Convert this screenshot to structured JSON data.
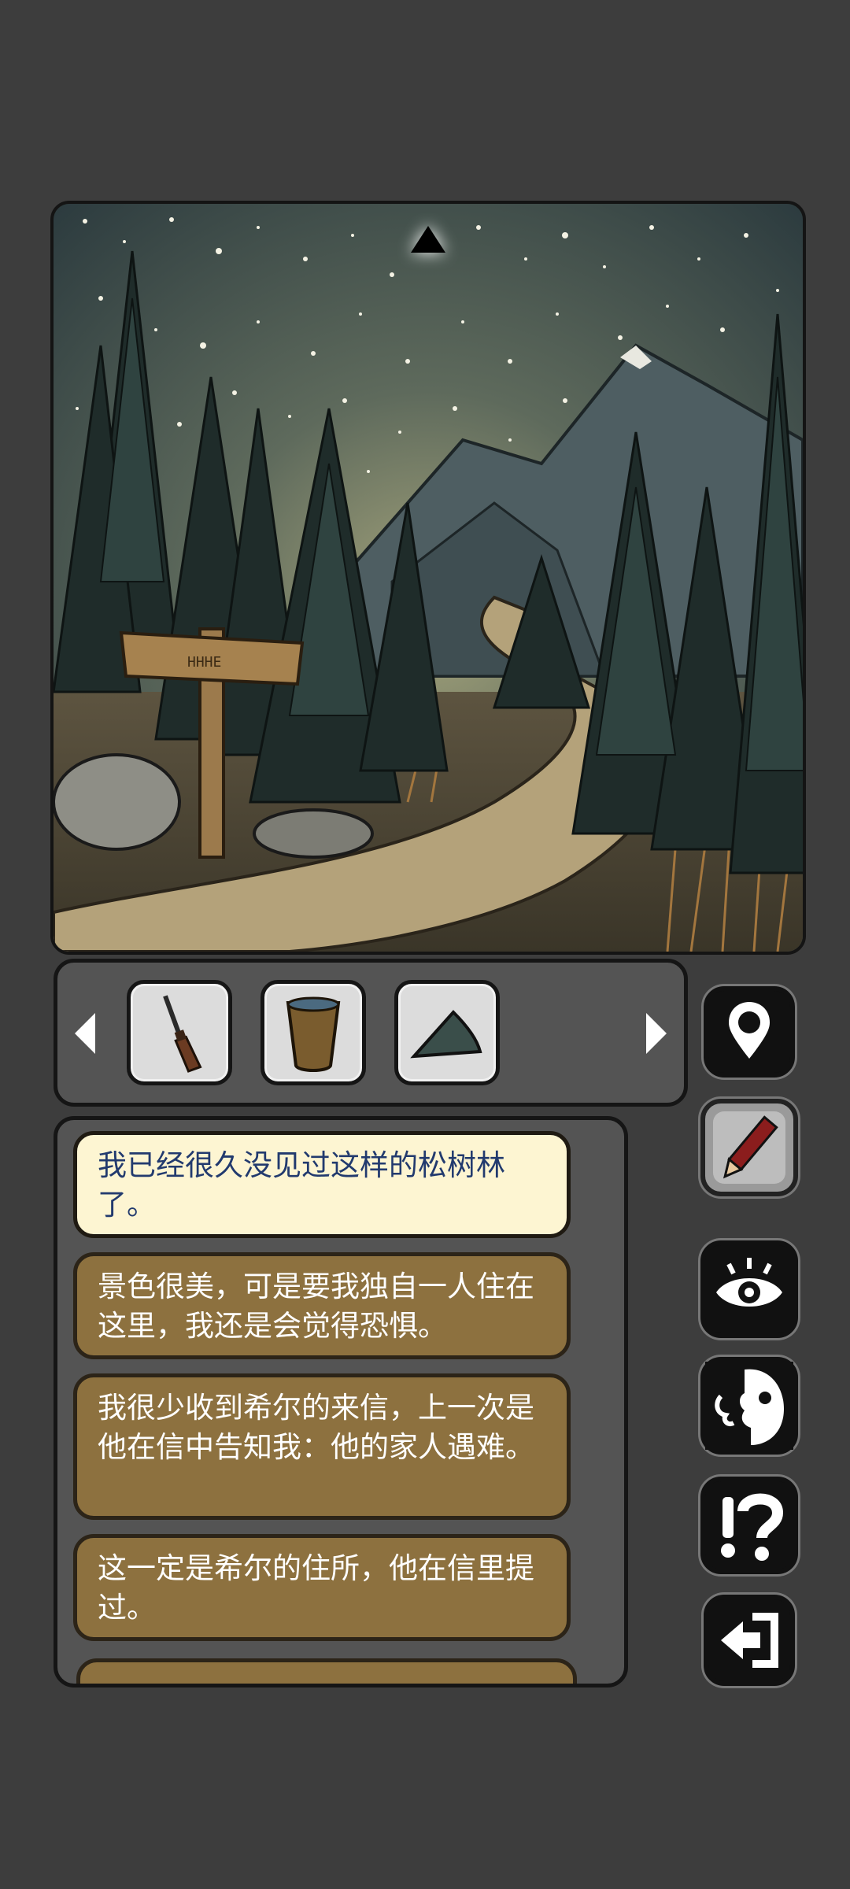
{
  "scene": {
    "signpost_text": "HHHE"
  },
  "inventory": {
    "items": [
      {
        "name": "rifle"
      },
      {
        "name": "wooden-cup"
      },
      {
        "name": "gramophone-horn"
      }
    ]
  },
  "side_buttons": [
    {
      "icon": "map-pin-icon"
    },
    {
      "icon": "pencil-icon"
    },
    {
      "icon": "eye-icon"
    },
    {
      "icon": "face-speak-icon"
    },
    {
      "icon": "hint-icon"
    },
    {
      "icon": "exit-icon"
    }
  ],
  "dialog": {
    "messages": [
      "我已经很久没见过这样的松树林了。",
      "景色很美，可是要我独自一人住在这里，我还是会觉得恐惧。",
      "我很少收到希尔的来信，上一次是他在信中告知我：他的家人遇难。",
      "这一定是希尔的住所，他在信里提过。"
    ]
  },
  "colors": {
    "background": "#3d3d3d",
    "panel": "#545454",
    "message_active": "#fdf5d2",
    "message_normal": "#8d713f",
    "text_active": "#223a6e"
  }
}
